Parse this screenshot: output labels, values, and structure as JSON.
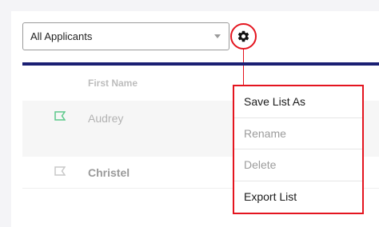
{
  "filter": {
    "selected": "All Applicants"
  },
  "table": {
    "columns": [
      "First Name"
    ],
    "rows": [
      {
        "first_name": "Audrey",
        "flag_color": "#5cc98a"
      },
      {
        "first_name": "Christel",
        "flag_color": "#c8c8c8"
      }
    ]
  },
  "settings": {
    "icon": "gear-icon",
    "highlight_color": "#e4151f",
    "menu": [
      {
        "label": "Save List As",
        "enabled": true
      },
      {
        "label": "Rename",
        "enabled": false
      },
      {
        "label": "Delete",
        "enabled": false
      },
      {
        "label": "Export List",
        "enabled": true
      }
    ]
  },
  "colors": {
    "header_rule": "#1a1f73"
  }
}
